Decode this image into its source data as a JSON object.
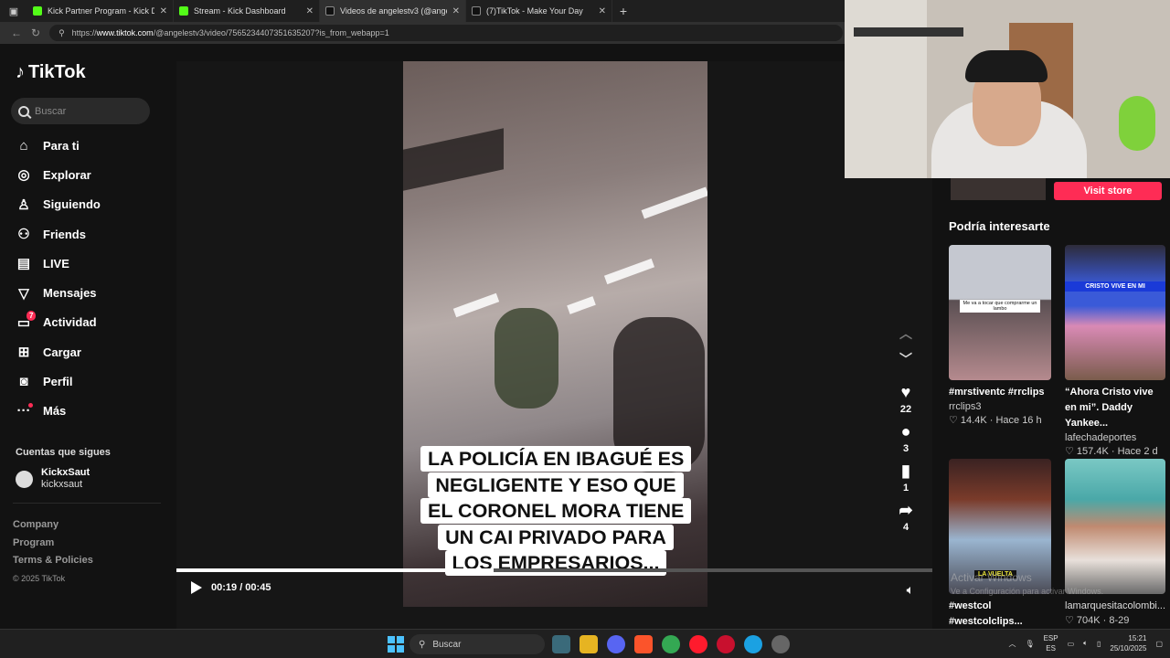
{
  "browser": {
    "tabs": [
      {
        "title": "Kick Partner Program - Kick Dashb",
        "icon": "kick-icon"
      },
      {
        "title": "Stream - Kick Dashboard",
        "icon": "kick-icon"
      },
      {
        "title": "Videos de angelestv3 (@angelest",
        "icon": "tiktok-icon",
        "active": true
      },
      {
        "title": "(7)TikTok - Make Your Day",
        "icon": "tiktok-icon"
      }
    ],
    "url_prefix": "https://",
    "url_host": "www.tiktok.com",
    "url_path": "/@angelestv3/video/7565234407351635207?is_from_webapp=1"
  },
  "sidebar": {
    "logo": "TikTok",
    "search_placeholder": "Buscar",
    "items": [
      {
        "label": "Para ti",
        "icon": "home-icon"
      },
      {
        "label": "Explorar",
        "icon": "compass-icon"
      },
      {
        "label": "Siguiendo",
        "icon": "following-icon"
      },
      {
        "label": "Friends",
        "icon": "friends-icon"
      },
      {
        "label": "LIVE",
        "icon": "live-icon"
      },
      {
        "label": "Mensajes",
        "icon": "messages-icon"
      },
      {
        "label": "Actividad",
        "icon": "activity-icon",
        "badge": "7"
      },
      {
        "label": "Cargar",
        "icon": "upload-icon"
      },
      {
        "label": "Perfil",
        "icon": "profile-icon"
      },
      {
        "label": "Más",
        "icon": "more-icon"
      }
    ],
    "following_heading": "Cuentas que sigues",
    "following": [
      {
        "name": "KickxSaut",
        "handle": "kickxsaut"
      }
    ],
    "footer": [
      "Company",
      "Program",
      "Terms & Policies"
    ],
    "copyright": "© 2025 TikTok"
  },
  "video": {
    "caption": "LA POLICÍA EN IBAGUÉ ES NEGLIGENTE Y ESO QUE EL CORONEL MORA TIENE UN CAI PRIVADO PARA LOS EMPRESARIOS...",
    "time": "00:19 / 00:45",
    "progress": 0.42,
    "author": "angelestv3",
    "likes": "22",
    "comments": "3",
    "saves": "1",
    "shares": "4"
  },
  "right": {
    "visit_store": "Visit store",
    "recommend_title": "Podría interesarte",
    "cards": [
      {
        "caption": "#mrstiventc #rrclips",
        "user": "rrclips3",
        "likes": "14.4K",
        "age": "Hace 16 h",
        "thumb_text": "Me va a tocar que comprarme un lambo"
      },
      {
        "caption": "“Ahora Cristo vive en mi”. Daddy Yankee...",
        "user": "lafechadeportes",
        "likes": "157.4K",
        "age": "Hace 2 d",
        "thumb_text": "CRISTO VIVE EN MI"
      },
      {
        "caption": "#westcol #westcolclips...",
        "user": "",
        "likes": "",
        "age": "",
        "thumb_text": "LA VUELTA"
      },
      {
        "caption": "",
        "user": "lamarquesitacolombi...",
        "likes": "704K",
        "age": "8-29",
        "thumb_text": ""
      }
    ]
  },
  "os": {
    "watermark": "Activar Windows",
    "watermark_sub": "Ve a Configuración para activar Windows.",
    "search": "Buscar",
    "lang1": "ESP",
    "lang2": "ES",
    "time": "15:21",
    "date": "25/10/2025"
  },
  "colors": {
    "accent": "#fe2c55",
    "kick": "#53fc18",
    "bg": "#121212"
  }
}
